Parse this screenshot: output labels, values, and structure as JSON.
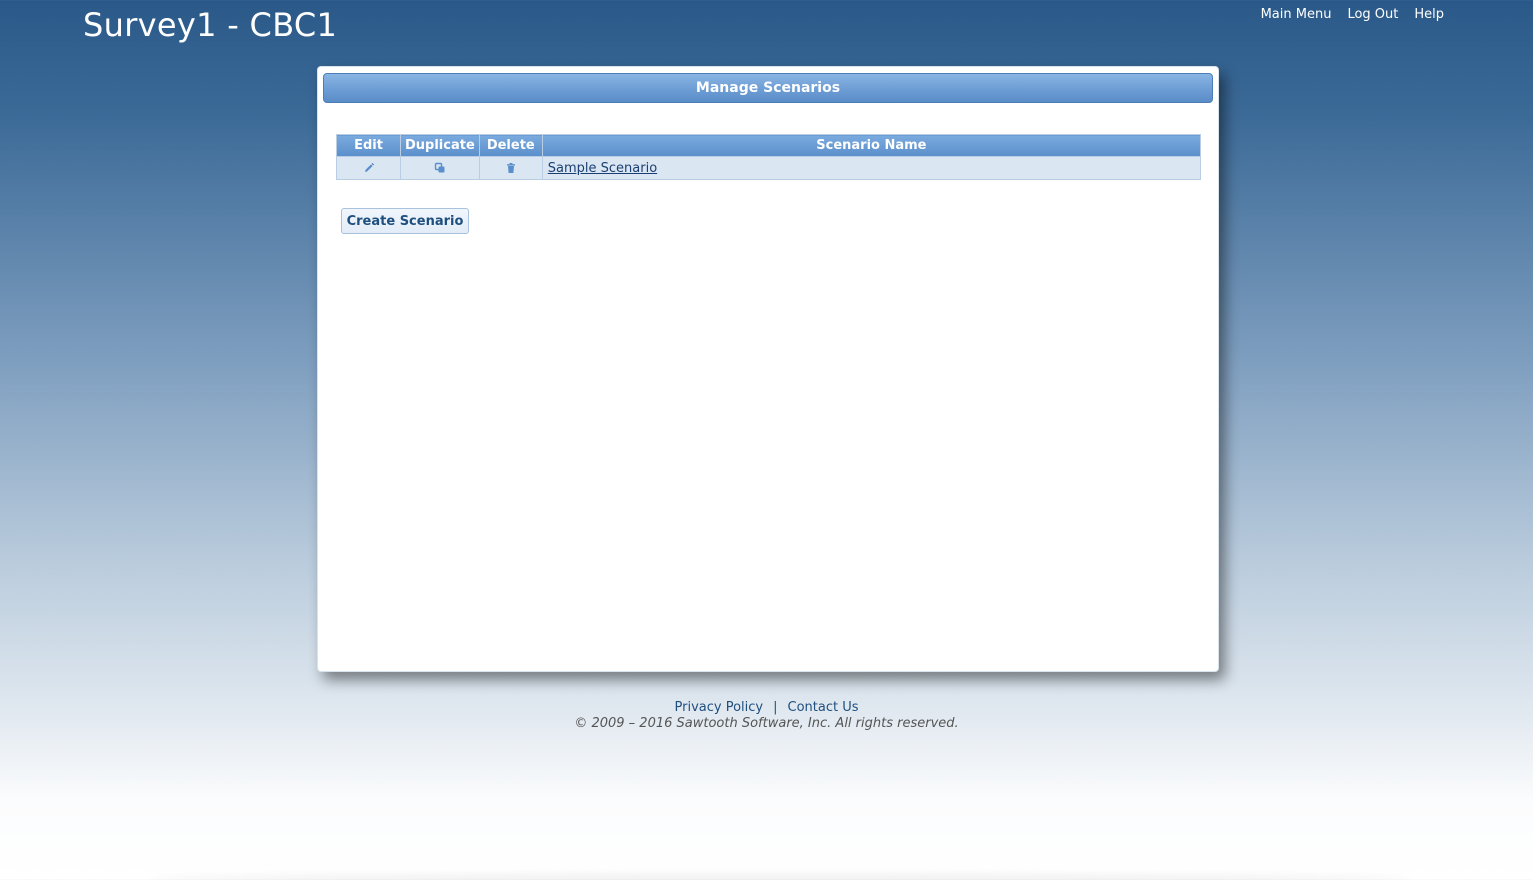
{
  "header": {
    "title": "Survey1 - CBC1",
    "nav": [
      "Main Menu",
      "Log Out",
      "Help"
    ]
  },
  "panel": {
    "title": "Manage Scenarios",
    "table": {
      "columns": [
        "Edit",
        "Duplicate",
        "Delete",
        "Scenario Name"
      ],
      "rows": [
        {
          "edit_icon": "pencil-icon",
          "duplicate_icon": "copy-icon",
          "delete_icon": "trash-icon",
          "name": "Sample Scenario"
        }
      ]
    },
    "create_button": "Create Scenario"
  },
  "footer": {
    "links": [
      "Privacy Policy",
      "Contact Us"
    ],
    "separator": "|",
    "copyright": "© 2009 – 2016 Sawtooth Software, Inc.  All rights reserved."
  },
  "colors": {
    "header_bg": "#2a5989",
    "panel_header": "#6f9fd6",
    "row_bg": "#dbe6f3",
    "link": "#1f4f7f"
  }
}
